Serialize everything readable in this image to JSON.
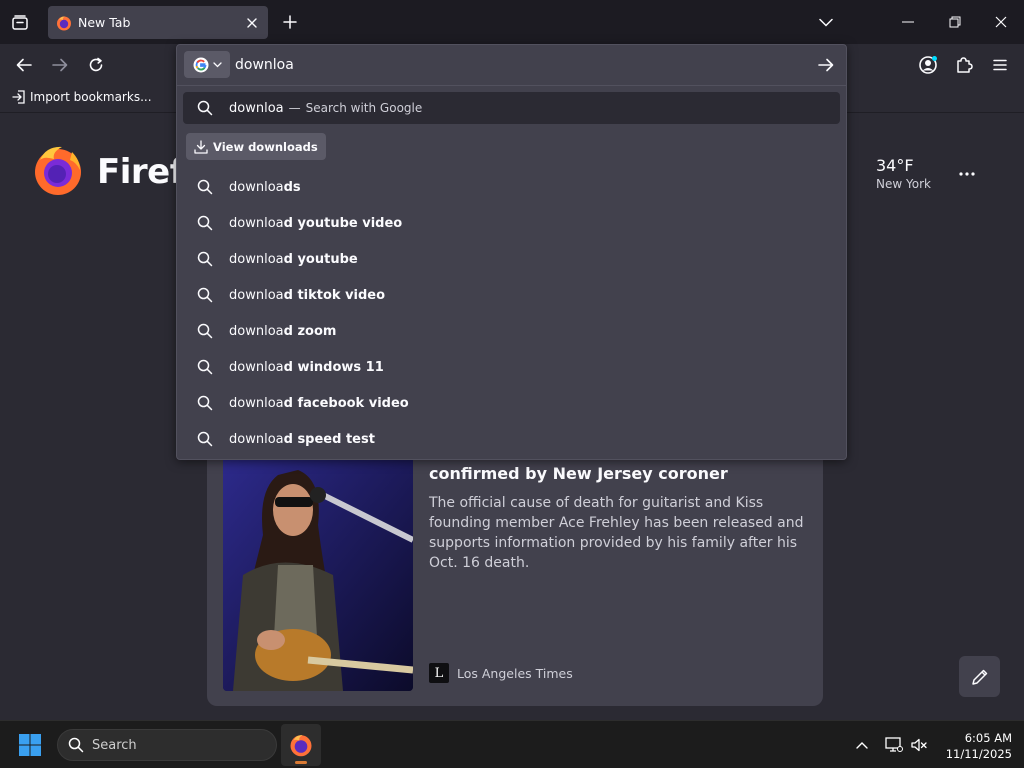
{
  "colors": {
    "tabstrip_bg": "#1c1b22",
    "toolbar_bg": "#2b2a33",
    "popup_bg": "#42414d",
    "text": "#fbfbfe",
    "taskbar_bg": "#1c1c1c"
  },
  "tab": {
    "title": "New Tab",
    "favicon": "firefox-icon"
  },
  "bookmarks": {
    "import_label": "Import bookmarks..."
  },
  "urlbar": {
    "value": "downloa",
    "engine_icon": "google-icon",
    "first_row": {
      "query": "downloa",
      "separator": "—",
      "action": "Search with Google"
    },
    "view_downloads_label": "View downloads",
    "suggestions": [
      {
        "typed": "downloa",
        "rest": "ds"
      },
      {
        "typed": "downloa",
        "rest": "d youtube video"
      },
      {
        "typed": "downloa",
        "rest": "d youtube"
      },
      {
        "typed": "downloa",
        "rest": "d tiktok video"
      },
      {
        "typed": "downloa",
        "rest": "d zoom"
      },
      {
        "typed": "downloa",
        "rest": "d windows 11"
      },
      {
        "typed": "downloa",
        "rest": "d facebook video"
      },
      {
        "typed": "downloa",
        "rest": "d speed test"
      }
    ]
  },
  "newtab": {
    "wordmark": "Firefo",
    "weather": {
      "temp": "34°F",
      "city": "New York"
    },
    "story": {
      "title": "confirmed by New Jersey coroner",
      "excerpt": "The official cause of death for guitarist and Kiss founding member Ace Frehley has been released and supports information provided by his family after his Oct. 16 death.",
      "source": "Los Angeles Times",
      "source_logo": "L"
    }
  },
  "taskbar": {
    "search_label": "Search",
    "time": "6:05 AM",
    "date": "11/11/2025"
  }
}
